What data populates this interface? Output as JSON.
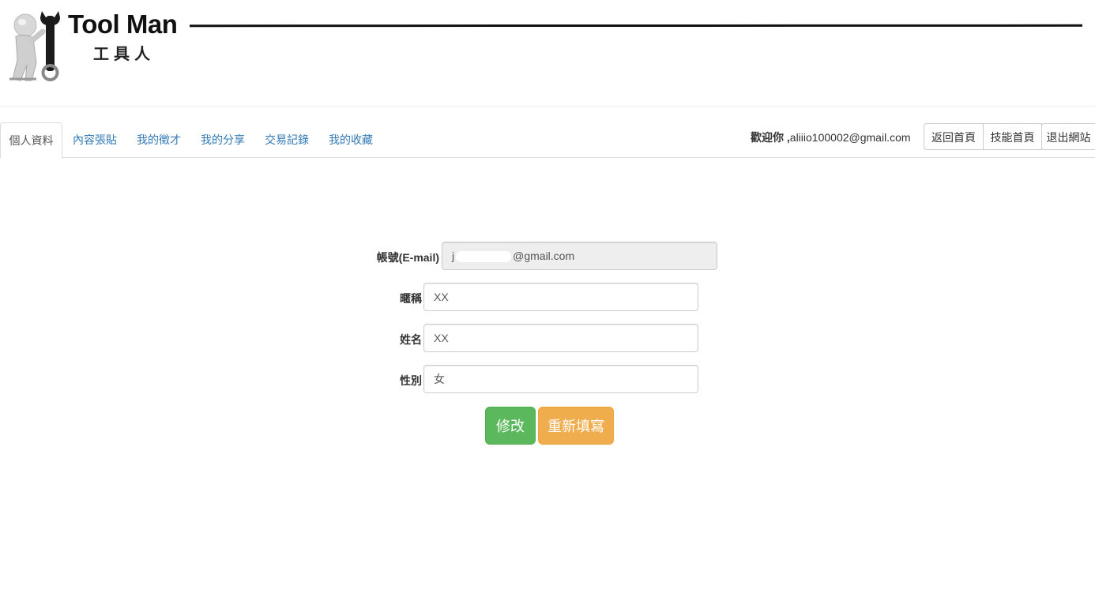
{
  "brand": {
    "title": "Tool Man",
    "subtitle": "工具人"
  },
  "nav": {
    "tabs": [
      {
        "label": "個人資料",
        "active": true
      },
      {
        "label": "內容張貼",
        "active": false
      },
      {
        "label": "我的徵才",
        "active": false
      },
      {
        "label": "我的分享",
        "active": false
      },
      {
        "label": "交易記錄",
        "active": false
      },
      {
        "label": "我的收藏",
        "active": false
      }
    ],
    "welcome_prefix": "歡迎你 ,",
    "welcome_email": "aliiio100002@gmail.com",
    "buttons": {
      "home": "返回首頁",
      "skills": "技能首頁",
      "logout": "退出網站"
    }
  },
  "form": {
    "account_label": "帳號(E-mail)",
    "account_prefix": "j",
    "account_suffix": "@gmail.com",
    "nickname_label": "暱稱",
    "nickname_value": "XX",
    "name_label": "姓名",
    "name_value": "XX",
    "gender_label": "性別",
    "gender_value": "女",
    "submit_label": "修改",
    "reset_label": "重新填寫"
  },
  "colors": {
    "link": "#337ab7",
    "success": "#5cb85c",
    "warning": "#f0ad4e"
  }
}
